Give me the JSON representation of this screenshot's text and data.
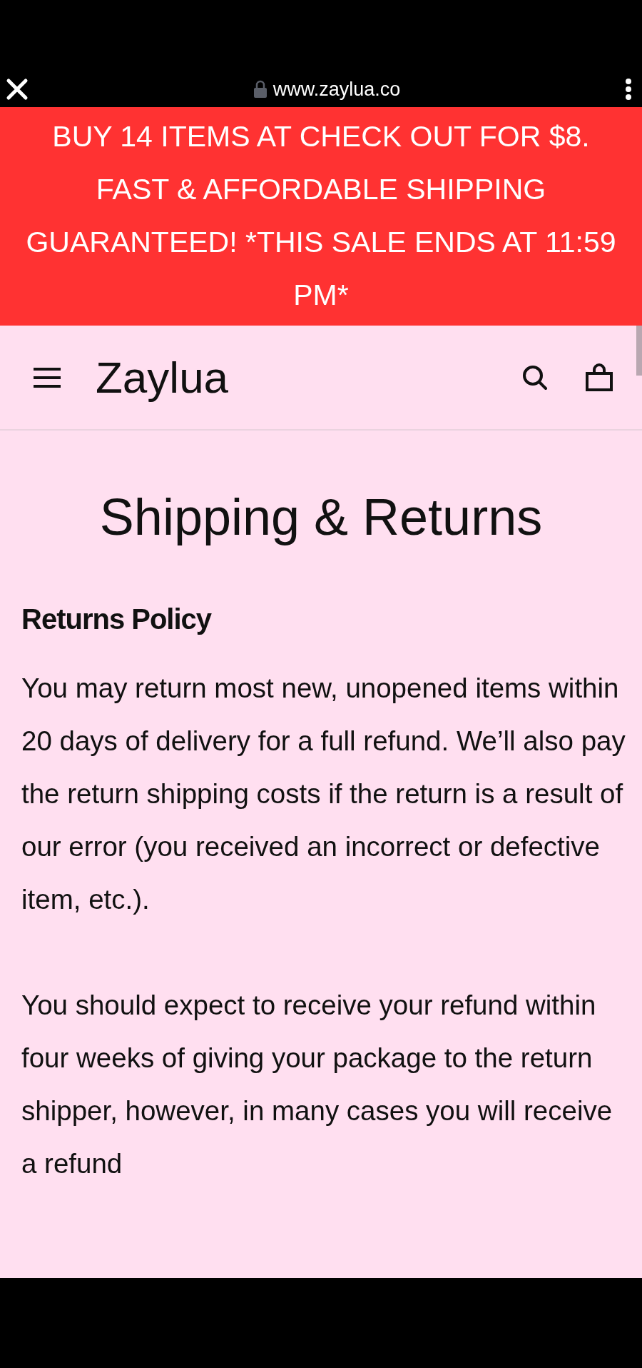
{
  "browser_bar": {
    "url": "www.zaylua.co"
  },
  "announcement_bar": {
    "text": "BUY 14 ITEMS AT CHECK OUT FOR $8. FAST & AFFORDABLE SHIPPING GUARANTEED! *THIS SALE ENDS AT 11:59 PM*"
  },
  "header": {
    "logo": "Zaylua"
  },
  "page": {
    "title": "Shipping & Returns",
    "section_heading": "Returns Policy",
    "paragraphs": [
      "You may return most new, unopened items within 20 days of delivery for a full refund. We’ll also pay the return shipping costs if the return is a result of our error (you received an incorrect or defective item, etc.).",
      "You should expect to receive your refund within four weeks of giving your package to the return shipper, however, in many cases you will receive a refund"
    ]
  }
}
